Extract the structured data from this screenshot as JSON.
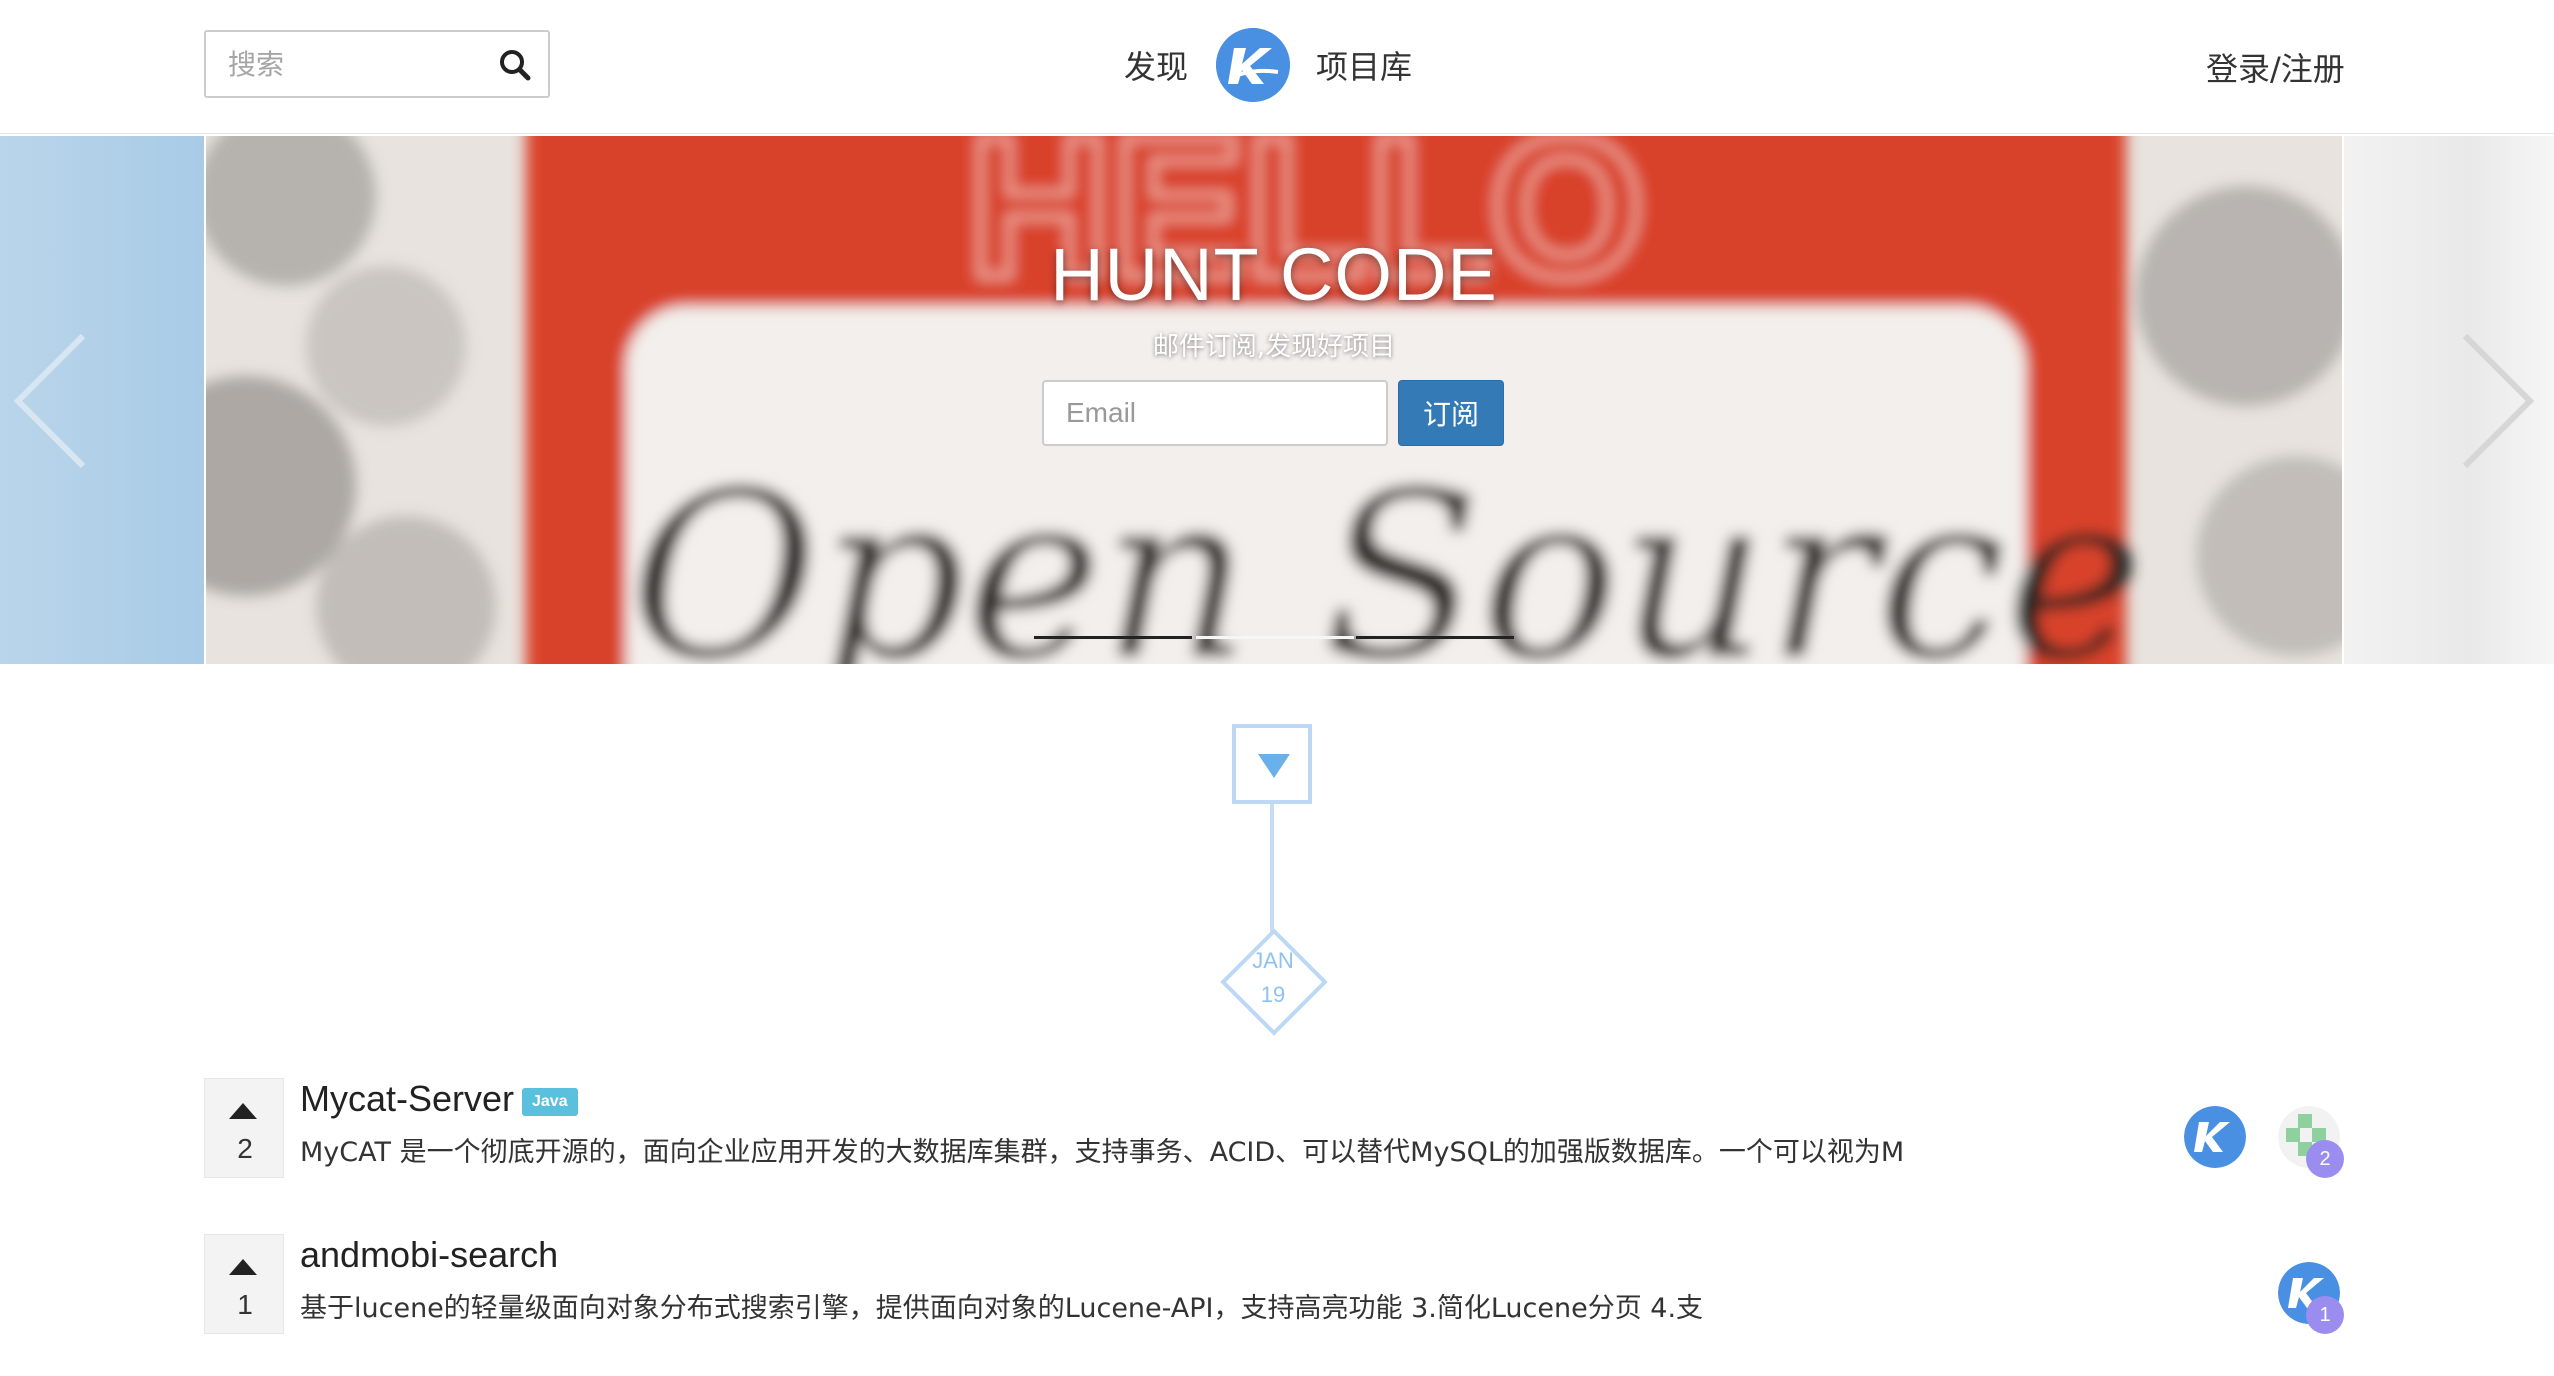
{
  "header": {
    "search": {
      "placeholder": "搜索",
      "value": ""
    },
    "nav": {
      "discover": "发现",
      "projects": "项目库"
    },
    "login": "登录/注册"
  },
  "hero": {
    "title": "HUNT CODE",
    "subtitle": "邮件订阅,发现好项目",
    "email_placeholder": "Email",
    "subscribe_label": "订阅"
  },
  "timeline": {
    "month": "JAN",
    "day": "19"
  },
  "projects": [
    {
      "votes": "2",
      "name": "Mycat-Server",
      "tag": "Java",
      "description": "MyCAT 是一个彻底开源的，面向企业应用开发的大数据库集群，支持事务、ACID、可以替代MySQL的加强版数据库。一个可以视为M",
      "contributors_count": "2"
    },
    {
      "votes": "1",
      "name": "andmobi-search",
      "tag": "",
      "description": "基于lucene的轻量级面向对象分布式搜索引擎，提供面向对象的Lucene-API，支持高亮功能 3.简化Lucene分页 4.支",
      "contributors_count": "1"
    }
  ],
  "colors": {
    "accent": "#337ab7",
    "logo": "#4a90e2",
    "tag": "#5bc0de",
    "timeline": "#bcd8f4",
    "badge": "#9b8df0"
  }
}
